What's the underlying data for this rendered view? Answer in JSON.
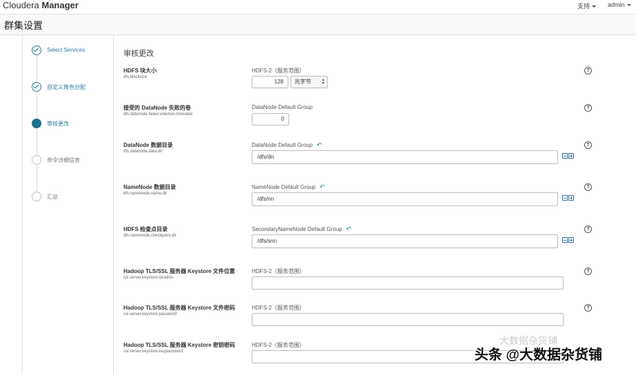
{
  "header": {
    "brand_light": "Cloudera ",
    "brand_bold": "Manager",
    "support": "支持",
    "user": "admin"
  },
  "page_title": "群集设置",
  "steps": [
    {
      "label": "Select Services",
      "state": "done"
    },
    {
      "label": "自定义角色分配",
      "state": "done"
    },
    {
      "label": "审核更改",
      "state": "active"
    },
    {
      "label": "命令详细信息",
      "state": "todo"
    },
    {
      "label": "汇总",
      "state": "todo"
    }
  ],
  "section_title": "审核更改",
  "params": [
    {
      "name": "HDFS 块大小",
      "key": "dfs.blocksize",
      "group": "HDFS-2（服务范围）",
      "value": "128",
      "unit": "兆字节"
    },
    {
      "name": "接受的 DataNode 失败的卷",
      "key": "dfs.datanode.failed.volumes.tolerated",
      "group": "DataNode Default Group",
      "value": "0"
    },
    {
      "name": "DataNode 数据目录",
      "key": "dfs.datanode.data.dir",
      "group": "DataNode Default Group",
      "value": "/dfs/dn"
    },
    {
      "name": "NameNode 数据目录",
      "key": "dfs.namenode.name.dir",
      "group": "NameNode Default Group",
      "value": "/dfs/nn"
    },
    {
      "name": "HDFS 检查点目录",
      "key": "dfs.namenode.checkpoint.dir",
      "group": "SecondaryNameNode Default Group",
      "value": "/dfs/snn"
    },
    {
      "name": "Hadoop TLS/SSL 服务器 Keystore 文件位置",
      "key": "ssl.server.keystore.location",
      "group": "HDFS-2（服务范围）",
      "value": ""
    },
    {
      "name": "Hadoop TLS/SSL 服务器 Keystore 文件密码",
      "key": "ssl.server.keystore.password",
      "group": "HDFS-2（服务范围）",
      "value": ""
    },
    {
      "name": "Hadoop TLS/SSL 服务器 Keystore 密钥密码",
      "key": "ssl.server.keystore.keypassword",
      "group": "HDFS-2（服务范围）",
      "value": ""
    }
  ],
  "watermark": "头条 @大数据杂货铺",
  "watermark_faint": "大数据杂货铺",
  "colors": {
    "accent": "#2f7d9a",
    "active_step": "#1f6e87"
  }
}
